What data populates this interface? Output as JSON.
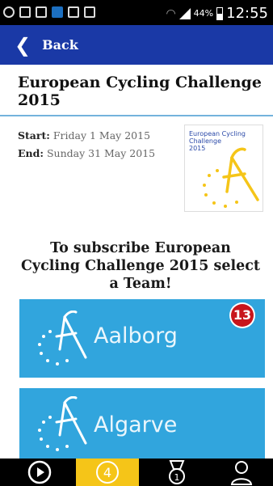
{
  "status_bar": {
    "battery": "44%",
    "time": "12:55",
    "battery_level": 0.44
  },
  "nav": {
    "back_label": "Back"
  },
  "challenge": {
    "title": "European Cycling Challenge 2015",
    "start_label": "Start:",
    "start_value": "Friday 1 May 2015",
    "end_label": "End:",
    "end_value": "Sunday 31 May 2015",
    "logo_text": [
      "European Cycling",
      "Challenge",
      "2015"
    ]
  },
  "subscribe_prompt": "To subscribe European Cycling Challenge 2015 select a Team!",
  "teams": [
    {
      "name": "Aalborg",
      "badge": "13"
    },
    {
      "name": "Algarve"
    }
  ],
  "bottom_tabs": [
    {
      "icon": "play-icon"
    },
    {
      "icon": "number-four-icon",
      "label": "4",
      "active": true
    },
    {
      "icon": "medal-icon",
      "label": "1"
    },
    {
      "icon": "user-icon"
    }
  ],
  "colors": {
    "topbar": "#1a39a6",
    "team_card": "#31a5dd",
    "accent_yellow": "#f5c518",
    "badge": "#c8151c",
    "divider": "#74b3dc"
  }
}
